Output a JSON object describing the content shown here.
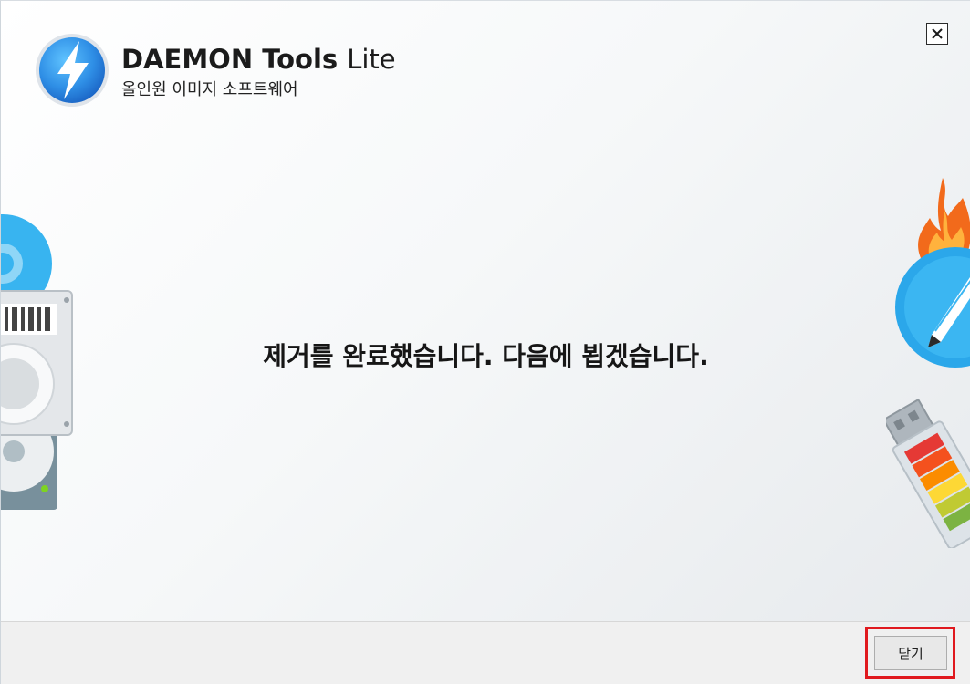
{
  "app": {
    "name_bold": "DAEMON Tools",
    "name_light": "Lite",
    "subtitle": "올인원 이미지 소프트웨어"
  },
  "main": {
    "message": "제거를 완료했습니다. 다음에 뵙겠습니다."
  },
  "footer": {
    "close_label": "닫기"
  },
  "icons": [
    "daemon-tools-logo-icon",
    "close-icon",
    "disc-icon",
    "hard-drive-icon",
    "flame-icon",
    "pencil-icon",
    "usb-drive-icon"
  ],
  "colors": {
    "brand_blue": "#2f8fe6",
    "highlight": "#e0191e",
    "flame": "#f26a1b",
    "footer_bg": "#f0f0f0"
  }
}
